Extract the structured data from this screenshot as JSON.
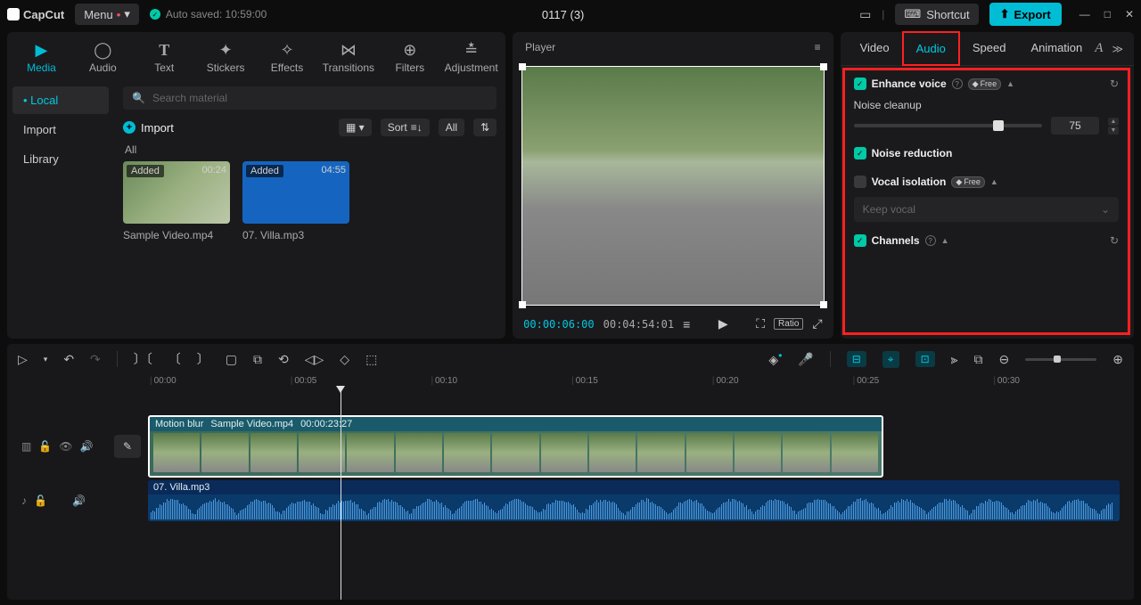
{
  "top": {
    "app": "CapCut",
    "menu": "Menu",
    "autosave": "Auto saved: 10:59:00",
    "title": "0117 (3)",
    "shortcut": "Shortcut",
    "export": "Export"
  },
  "tabs": {
    "media": "Media",
    "audio": "Audio",
    "text": "Text",
    "stickers": "Stickers",
    "effects": "Effects",
    "transitions": "Transitions",
    "filters": "Filters",
    "adjustment": "Adjustment"
  },
  "source": {
    "local": "Local",
    "import_side": "Import",
    "library": "Library"
  },
  "media": {
    "search_ph": "Search material",
    "import": "Import",
    "sort": "Sort",
    "all": "All",
    "lib_all": "All",
    "items": [
      {
        "added": "Added",
        "dur": "00:24",
        "name": "Sample Video.mp4",
        "kind": "video"
      },
      {
        "added": "Added",
        "dur": "04:55",
        "name": "07. Villa.mp3",
        "kind": "audio"
      }
    ]
  },
  "player": {
    "label": "Player",
    "tc_cur": "00:00:06:00",
    "tc_tot": "00:04:54:01",
    "ratio": "Ratio"
  },
  "insp_tabs": {
    "video": "Video",
    "audio": "Audio",
    "speed": "Speed",
    "animation": "Animation"
  },
  "insp": {
    "enhance": "Enhance voice",
    "free": "Free",
    "cleanup": "Noise cleanup",
    "cleanup_val": "75",
    "noise_red": "Noise reduction",
    "vocal_iso": "Vocal isolation",
    "keep_vocal": "Keep vocal",
    "channels": "Channels"
  },
  "ruler": [
    "00:00",
    "00:05",
    "00:10",
    "00:15",
    "00:20",
    "00:25",
    "00:30"
  ],
  "clip": {
    "effect": "Motion blur",
    "name": "Sample Video.mp4",
    "tc": "00:00:23:27",
    "audio_name": "07. Villa.mp3"
  }
}
